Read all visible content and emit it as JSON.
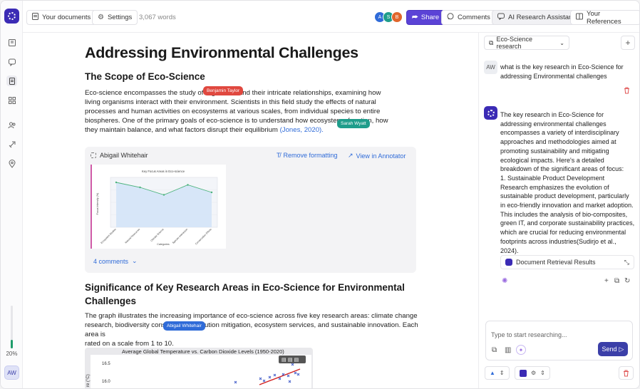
{
  "topbar": {
    "your_documents": "Your documents",
    "settings": "Settings",
    "word_count": "3,067 words",
    "collaborators": [
      {
        "initial": "A",
        "color": "#2f6bd8"
      },
      {
        "initial": "S",
        "color": "#1f9d8b"
      },
      {
        "initial": "B",
        "color": "#e0662c"
      }
    ],
    "share": "Share",
    "comments": "Comments",
    "ai_assistant": "AI Research Assistant",
    "references": "Your References"
  },
  "rail": {
    "progress_value": 20,
    "progress_label": "20%",
    "user_initials": "AW"
  },
  "document": {
    "title": "Addressing Environmental Challenges",
    "section1_heading": "The Scope of Eco-Science",
    "para1_lines": [
      "Eco-science encompasses the study of organisms and their intricate relationships, examining how",
      "living organisms interact with their environment. Scientists in this field study the effects of natural",
      "processes and human activities on ecosystems at various scales, from individual species to entire",
      "biospheres. One of the primary goals of eco-science is to understand how ecosystems function, how",
      "they maintain balance, and what factors disrupt their equilibrium "
    ],
    "para1_citation": "(Jones, 2020).",
    "cursor1": {
      "name": "Benjamin Taylor",
      "color": "#e0483f"
    },
    "cursor2": {
      "name": "Sarah Wyatt",
      "color": "#1f9d8b"
    },
    "card": {
      "author": "Abigail Whitehair",
      "remove_formatting": "Remove formatting",
      "view_annotator": "View in Annotator",
      "comments": "4 comments"
    },
    "section2_heading_lines": [
      "Significance of Key Research Areas in Eco-Science for Environmental",
      "Challenges"
    ],
    "para2_lines": [
      "The graph illustrates the increasing importance of eco-science across five key research areas: climate change",
      "research, biodiversity conservation, pollution mitigation, ecosystem services, and sustainable innovation. Each area is",
      "rated on a scale from 1 to 10."
    ],
    "cursor3": {
      "name": "Abigail Whitehair",
      "color": "#2f6bd8"
    },
    "chart2_title": "Average Global Temperature vs. Carbon Dioxide Levels (1950-2020)",
    "chart2_yticks": [
      "16.5",
      "16.0"
    ],
    "chart2_ylabel": "re (°C)"
  },
  "chart_data": {
    "type": "area",
    "title": "Key Focus Areas in Eco-science",
    "xlabel": "Categories",
    "ylabel": "Focus Intensity (%)",
    "categories": [
      "Ecosystem Studies",
      "Natural Resources",
      "Climate Science",
      "Species Interaction",
      "Conservation Efforts"
    ],
    "values": [
      90,
      80,
      65,
      85,
      70
    ],
    "ylim": [
      0,
      100
    ]
  },
  "panel": {
    "context_select": "Eco-Science research",
    "user_initials": "AW",
    "question": "what is the key research in Eco-Science for addressing Environmental challenges",
    "answer_intro": "The key research in Eco-Science for addressing environmental challenges encompasses a variety of interdisciplinary approaches and methodologies aimed at promoting sustainability and mitigating ecological impacts. Here's a detailed breakdown of the significant areas of focus:",
    "answer_item_title": "1.  Sustainable Product Development",
    "answer_item_body": "Research emphasizes the evolution of sustainable product development, particularly in eco-friendly innovation and market adoption. This includes the analysis of bio-composites, green IT, and corporate sustainability practices, which are crucial for reducing environmental footprints across industries(Sudirjo et al., 2024).",
    "retrieval_label": "Document Retrieval Results",
    "input_placeholder": "Type to start researching...",
    "send": "Send"
  }
}
